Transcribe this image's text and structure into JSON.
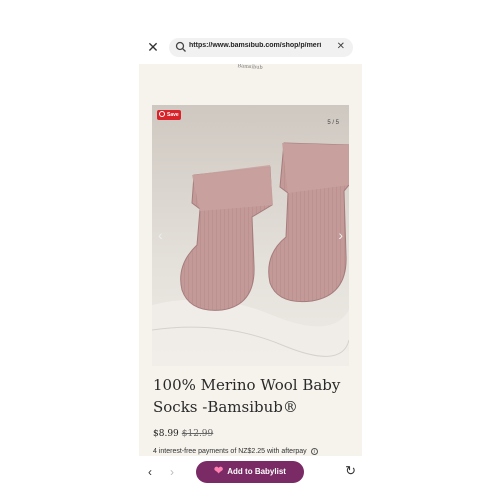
{
  "browser": {
    "url": "https://www.bamsibub.com/shop/p/meri",
    "close_icon": "close-icon",
    "search_icon": "search-icon",
    "clear_icon": "clear-icon"
  },
  "site": {
    "logo_text": "Bamsibub"
  },
  "gallery": {
    "save_label": "Save",
    "counter": "5 / 5",
    "prev_icon": "chevron-left-icon",
    "next_icon": "chevron-right-icon"
  },
  "product": {
    "title": "100% Merino Wool Baby Socks -Bamsibub®",
    "price": "$8.99",
    "old_price": "$12.99",
    "installments": "4 interest-free payments of NZ$2.25 with afterpay"
  },
  "bottom": {
    "babylist_label": "Add to Babylist",
    "back_icon": "chevron-left-icon",
    "forward_icon": "chevron-right-icon",
    "reload_icon": "reload-icon"
  },
  "colors": {
    "page_bg": "#f6f3ec",
    "babylist_button": "#7a2a65",
    "save_badge": "#d9232b"
  }
}
